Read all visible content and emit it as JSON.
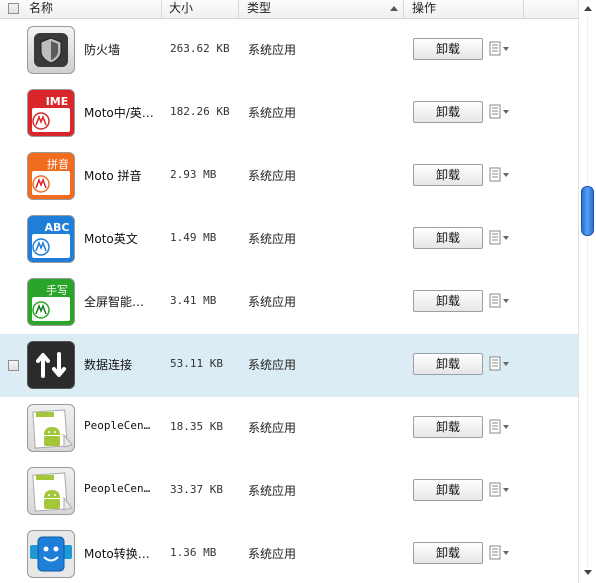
{
  "header": {
    "name": "名称",
    "size": "大小",
    "type": "类型",
    "action": "操作"
  },
  "rows": [
    {
      "name": "防火墙",
      "size": "263.62 KB",
      "type": "系统应用",
      "action": "卸载",
      "icon": "firewall-icon",
      "highlighted": false
    },
    {
      "name": "Moto中/英…",
      "size": "182.26 KB",
      "type": "系统应用",
      "action": "卸载",
      "icon": "moto-ime-icon",
      "icon_text": "IME",
      "highlighted": false
    },
    {
      "name": "Moto 拼音",
      "size": "2.93 MB",
      "type": "系统应用",
      "action": "卸载",
      "icon": "moto-pinyin-icon",
      "icon_text": "拼音",
      "highlighted": false
    },
    {
      "name": "Moto英文",
      "size": "1.49 MB",
      "type": "系统应用",
      "action": "卸载",
      "icon": "moto-english-icon",
      "icon_text": "ABC",
      "highlighted": false
    },
    {
      "name": "全屏智能…",
      "size": "3.41 MB",
      "type": "系统应用",
      "action": "卸载",
      "icon": "moto-handwriting-icon",
      "icon_text": "手写",
      "highlighted": false
    },
    {
      "name": "数据连接",
      "size": "53.11 KB",
      "type": "系统应用",
      "action": "卸载",
      "icon": "data-connection-icon",
      "highlighted": true
    },
    {
      "name": "PeopleCen…",
      "size": "18.35 KB",
      "type": "系统应用",
      "action": "卸载",
      "icon": "android-icon",
      "highlighted": false
    },
    {
      "name": "PeopleCen…",
      "size": "33.37 KB",
      "type": "系统应用",
      "action": "卸载",
      "icon": "android-icon",
      "highlighted": false
    },
    {
      "name": "Moto转换…",
      "size": "1.36 MB",
      "type": "系统应用",
      "action": "卸载",
      "icon": "moto-converter-icon",
      "highlighted": false
    }
  ],
  "colors": {
    "highlight_row": "#dcecf4",
    "moto_red": "#d9262b",
    "moto_orange": "#f26c1f",
    "moto_blue": "#1f7fd8",
    "moto_green": "#2aa52a",
    "scroll_thumb": "#3d86e3"
  }
}
